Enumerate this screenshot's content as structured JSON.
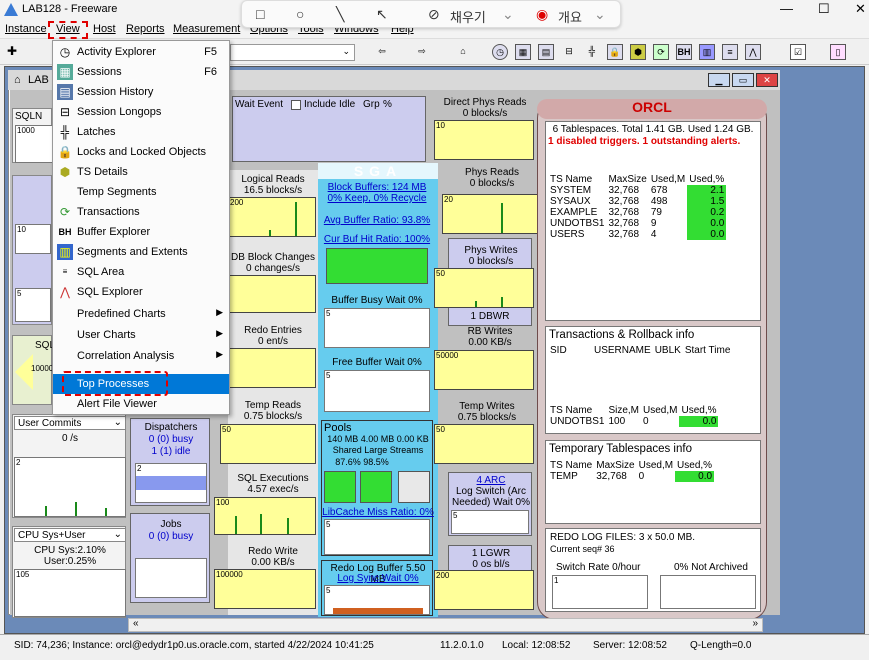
{
  "window": {
    "title": "LAB128 - Freeware",
    "minimize": "—",
    "maximize": "☐",
    "close": "✕"
  },
  "drawbar": {
    "fill_label": "채우기",
    "outline_label": "개요"
  },
  "menubar": [
    "Instance",
    "View",
    "Host",
    "Reports",
    "Measurement",
    "Options",
    "Tools",
    "Windows",
    "Help"
  ],
  "mdi": {
    "title": "LAB"
  },
  "dropdown": [
    {
      "label": "Activity Explorer",
      "shortcut": "F5",
      "icon": "clock-icon"
    },
    {
      "label": "Sessions",
      "shortcut": "F6",
      "icon": "sessions-icon"
    },
    {
      "label": "Session History",
      "shortcut": "",
      "icon": "history-icon"
    },
    {
      "label": "Session Longops",
      "shortcut": "",
      "icon": "longops-icon"
    },
    {
      "label": "Latches",
      "shortcut": "",
      "icon": "latch-icon"
    },
    {
      "label": "Locks and Locked Objects",
      "shortcut": "",
      "icon": "lock-icon"
    },
    {
      "label": "TS Details",
      "shortcut": "",
      "icon": "ts-icon"
    },
    {
      "label": "Temp Segments",
      "shortcut": "",
      "icon": ""
    },
    {
      "label": "Transactions",
      "shortcut": "",
      "icon": "transactions-icon"
    },
    {
      "label": "Buffer Explorer",
      "shortcut": "",
      "icon": "bh-icon"
    },
    {
      "label": "Segments and Extents",
      "shortcut": "",
      "icon": "segments-icon"
    },
    {
      "label": "SQL Area",
      "shortcut": "",
      "icon": "sql-icon"
    },
    {
      "label": "SQL Explorer",
      "shortcut": "",
      "icon": "sql-explorer-icon"
    },
    {
      "label": "Predefined Charts",
      "shortcut": "",
      "icon": "",
      "submenu": true
    },
    {
      "label": "User Charts",
      "shortcut": "",
      "icon": "",
      "submenu": true
    },
    {
      "label": "Correlation Analysis",
      "shortcut": "",
      "icon": "",
      "submenu": true
    },
    {
      "label": "Top Processes",
      "shortcut": "",
      "icon": "",
      "selected": true
    },
    {
      "label": "Alert File Viewer",
      "shortcut": "",
      "icon": ""
    }
  ],
  "left": {
    "sqln": "SQLN",
    "sqln_scale": "1000",
    "chart_10": "10",
    "chart_5": "5",
    "sql_label": "SQL",
    "scale_10000": "10000",
    "user_commits_select": "User Commits",
    "user_commits_value": "0 /s",
    "uc_scale": "2",
    "cpu_select": "CPU Sys+User",
    "cpu_sys": "CPU Sys:2.10%",
    "cpu_user": "User:0.25%",
    "cpu_scale": "105"
  },
  "panels": {
    "wait_event": "Wait Event",
    "include_idle": "Include Idle",
    "grp": "Grp",
    "grp_pct": "%",
    "logical_reads": "Logical Reads",
    "logical_reads_val": "16.5 blocks/s",
    "lr_scale": "200",
    "db_block_changes": "DB Block Changes",
    "dbbc_val": "0 changes/s",
    "redo_entries": "Redo Entries",
    "redo_entries_val": "0 ent/s",
    "temp_reads": "Temp Reads",
    "temp_reads_val": "0.75 blocks/s",
    "tr_scale": "50",
    "sql_exec": "SQL Executions",
    "sql_exec_val": "4.57 exec/s",
    "se_scale": "100",
    "redo_write": "Redo Write",
    "redo_write_val": "0.00 KB/s",
    "rw_scale": "100000",
    "dispatchers": "Dispatchers",
    "disp_busy": "0 (0) busy",
    "disp_idle": "1 (1) idle",
    "disp_scale": "2",
    "jobs": "Jobs",
    "jobs_busy": "0 (0) busy",
    "direct_phys_reads": "Direct Phys Reads",
    "dpr_val": "0 blocks/s",
    "dpr_scale": "10",
    "phys_reads": "Phys Reads",
    "pr_val": "0 blocks/s",
    "pr_scale": "20",
    "phys_writes": "Phys Writes",
    "pw_val": "0 blocks/s",
    "pw_scale": "50",
    "dbwr": "1 DBWR",
    "rb_writes": "RB Writes",
    "rbw_val": "0.00 KB/s",
    "rbw_scale": "50000",
    "temp_writes": "Temp Writes",
    "tw_val": "0.75 blocks/s",
    "tw_scale": "50",
    "arc": "4 ARC",
    "log_switch": "Log Switch (Arc Needed) Wait 0%",
    "arc_scale": "5",
    "lgwr": "1 LGWR",
    "lgwr_val": "0 os bl/s",
    "lgwr_scale": "200"
  },
  "sga": {
    "title": "SGA",
    "block_buffers": "Block Buffers: 124 MB",
    "keep_recycle": "0% Keep, 0% Recycle",
    "avg_buffer_ratio": "Avg Buffer Ratio: 93.8%",
    "cur_buf_hit": "Cur Buf Hit Ratio: 100%",
    "buffer_busy": "Buffer Busy Wait  0%",
    "bb_scale": "5",
    "free_buffer": "Free Buffer Wait  0%",
    "fb_scale": "5",
    "pools": "Pools",
    "pool_sizes": "140 MB 4.00 MB 0.00 KB",
    "pool_names": "Shared  Large  Streams",
    "pool_pcts": "87.6%  98.5%",
    "libcache": "LibCache Miss Ratio: 0%",
    "lc_scale": "5",
    "redo_log_buffer": "Redo Log Buffer 5.50 MB",
    "log_sync": "Log Sync Wait  0%",
    "ls_scale": "5"
  },
  "orcl": {
    "title": "ORCL",
    "summary": "6 Tablespaces. Total 1.41 GB. Used 1.24 GB.",
    "alerts": "1 disabled triggers. 1 outstanding alerts.",
    "ts_headers": [
      "TS Name",
      "MaxSize",
      "Used,M",
      "Used,%"
    ],
    "ts_rows": [
      [
        "SYSTEM",
        "32,768",
        "678",
        "2.1"
      ],
      [
        "SYSAUX",
        "32,768",
        "498",
        "1.5"
      ],
      [
        "EXAMPLE",
        "32,768",
        "79",
        "0.2"
      ],
      [
        "UNDOTBS1",
        "32,768",
        "9",
        "0.0"
      ],
      [
        "USERS",
        "32,768",
        "4",
        "0.0"
      ]
    ],
    "trans_title": "Transactions & Rollback info",
    "trans_headers": [
      "SID",
      "USERNAME",
      "UBLK",
      "Start Time"
    ],
    "undo_headers": [
      "TS Name",
      "Size,M",
      "Used,M",
      "Used,%"
    ],
    "undo_row": [
      "UNDOTBS1",
      "100",
      "0",
      "0.0"
    ],
    "temp_title": "Temporary Tablespaces info",
    "temp_headers": [
      "TS Name",
      "MaxSize",
      "Used,M",
      "Used,%"
    ],
    "temp_row": [
      "TEMP",
      "32,768",
      "0",
      "0.0"
    ],
    "redo_files": "REDO LOG FILES: 3 x 50.0 MB.",
    "current_seq": "Current seq# 36",
    "switch_rate": "Switch Rate 0/hour",
    "not_archived": "0% Not Archived",
    "sr_scale": "1"
  },
  "status": {
    "sid": "SID: 74,236; Instance: orcl@edydr1p0.us.oracle.com, started 4/22/2024 10:41:25",
    "version": "11.2.0.1.0",
    "local": "Local: 12:08:52",
    "server": "Server: 12:08:52",
    "qlength": "Q-Length=0.0"
  },
  "colors": {
    "accent": "#0078d7",
    "highlight": "#e00000",
    "sga": "#66ccee",
    "orcl": "#d9c8c8",
    "green": "#33dd33"
  }
}
